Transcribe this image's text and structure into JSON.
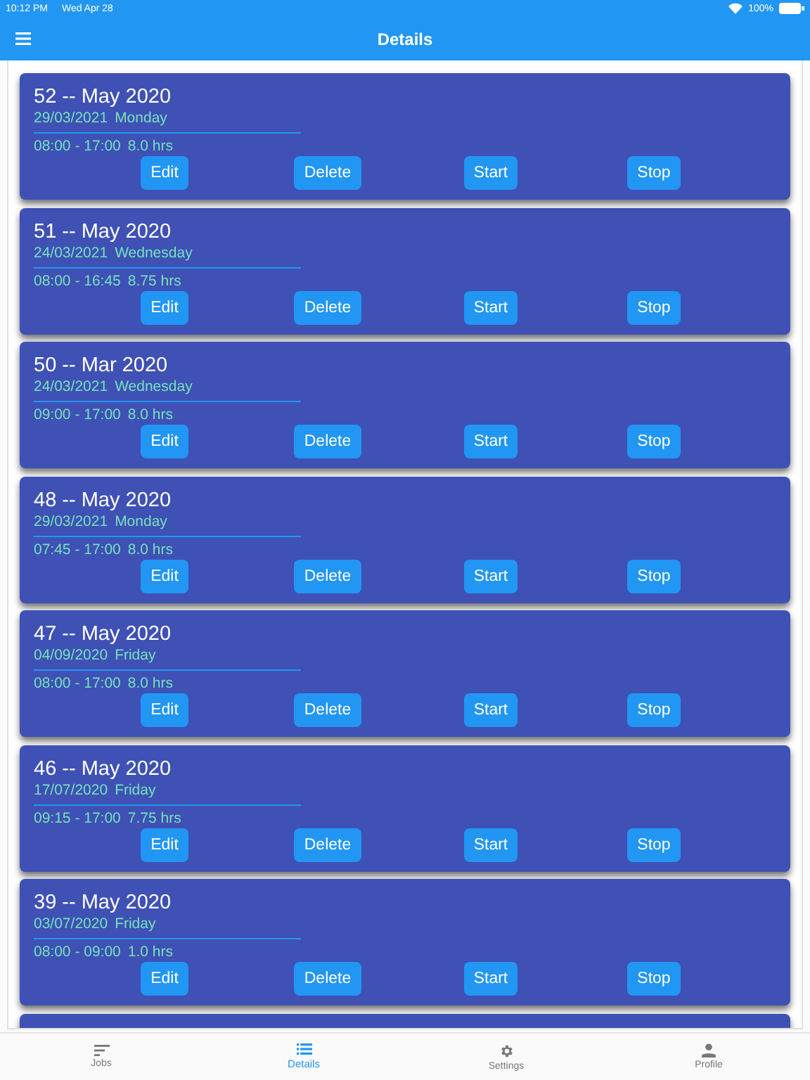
{
  "status_bar": {
    "time": "10:12 PM",
    "date": "Wed Apr 28",
    "battery": "100%"
  },
  "app_bar": {
    "title": "Details"
  },
  "entries": [
    {
      "title": "52 -- May 2020",
      "date": "29/03/2021",
      "day": "Monday",
      "hours": "08:00 - 17:00",
      "total": "8.0 hrs",
      "buttons": [
        "Edit",
        "Delete",
        "Start",
        "Stop"
      ]
    },
    {
      "title": "51 -- May 2020",
      "date": "24/03/2021",
      "day": "Wednesday",
      "hours": "08:00 - 16:45",
      "total": "8.75 hrs",
      "buttons": [
        "Edit",
        "Delete",
        "Start",
        "Stop"
      ]
    },
    {
      "title": "50 -- Mar 2020",
      "date": "24/03/2021",
      "day": "Wednesday",
      "hours": "09:00 - 17:00",
      "total": "8.0 hrs",
      "buttons": [
        "Edit",
        "Delete",
        "Start",
        "Stop"
      ]
    },
    {
      "title": "48 -- May 2020",
      "date": "29/03/2021",
      "day": "Monday",
      "hours": "07:45 - 17:00",
      "total": "8.0 hrs",
      "buttons": [
        "Edit",
        "Delete",
        "Start",
        "Stop"
      ]
    },
    {
      "title": "47 -- May 2020",
      "date": "04/09/2020",
      "day": "Friday",
      "hours": "08:00 - 17:00",
      "total": "8.0 hrs",
      "buttons": [
        "Edit",
        "Delete",
        "Start",
        "Stop"
      ]
    },
    {
      "title": "46 -- May 2020",
      "date": "17/07/2020",
      "day": "Friday",
      "hours": "09:15 - 17:00",
      "total": "7.75 hrs",
      "buttons": [
        "Edit",
        "Delete",
        "Start",
        "Stop"
      ]
    },
    {
      "title": "39 -- May 2020",
      "date": "03/07/2020",
      "day": "Friday",
      "hours": "08:00 - 09:00",
      "total": "1.0 hrs",
      "buttons": [
        "Edit",
        "Delete",
        "Start",
        "Stop"
      ]
    }
  ],
  "tabs": [
    {
      "label": "Jobs",
      "selected": false
    },
    {
      "label": "Details",
      "selected": true
    },
    {
      "label": "Settings",
      "selected": false
    },
    {
      "label": "Profile",
      "selected": false
    }
  ]
}
